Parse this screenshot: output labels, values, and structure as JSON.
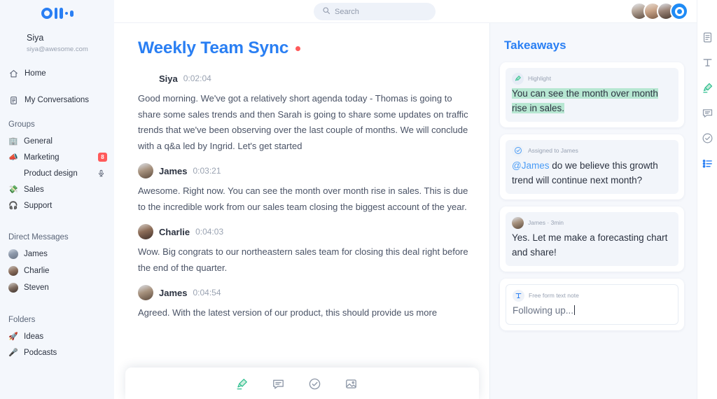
{
  "app": {
    "logo_name": "otter-logo"
  },
  "sidebar": {
    "user": {
      "name": "Siya",
      "email": "siya@awesome.com"
    },
    "nav": [
      {
        "label": "Home",
        "icon": "home-icon"
      },
      {
        "label": "My Conversations",
        "icon": "conversations-icon"
      }
    ],
    "groups_title": "Groups",
    "groups": [
      {
        "label": "General",
        "emoji": "🏢",
        "badge": ""
      },
      {
        "label": "Marketing",
        "emoji": "📣",
        "badge": "8"
      }
    ],
    "sub_item": {
      "label": "Product design",
      "icon": "microphone-icon"
    },
    "groups_after": [
      {
        "label": "Sales",
        "emoji": "💸",
        "badge": ""
      },
      {
        "label": "Support",
        "emoji": "🎧",
        "badge": ""
      }
    ],
    "dm_title": "Direct Messages",
    "dms": [
      {
        "label": "James"
      },
      {
        "label": "Charlie"
      },
      {
        "label": "Steven"
      }
    ],
    "folders_title": "Folders",
    "folders": [
      {
        "label": "Ideas",
        "emoji": "🚀"
      },
      {
        "label": "Podcasts",
        "emoji": "🎤"
      }
    ]
  },
  "topbar": {
    "search_placeholder": "Search",
    "search_value": "",
    "search_icon": "search-icon",
    "avatar_count": 3,
    "record_button_label": "record"
  },
  "transcript": {
    "title": "Weekly Team Sync",
    "recording_indicator": "live-recording-dot",
    "messages": [
      {
        "speaker": "Siya",
        "time": "0:02:04",
        "has_avatar": false,
        "text": "Good morning. We've got a relatively short agenda today - Thomas is going to share some sales trends and then Sarah is going to share some updates on traffic trends that we've been observing over the last couple of months. We will conclude with a q&a led by Ingrid. Let's get started"
      },
      {
        "speaker": "James",
        "time": "0:03:21",
        "has_avatar": true,
        "text": "Awesome. Right now. You can see the month over month rise in sales. This is due to the incredible work from our sales team closing the biggest account of the year."
      },
      {
        "speaker": "Charlie",
        "time": "0:04:03",
        "has_avatar": true,
        "text": "Wow. Big congrats to our northeastern sales team for closing this deal right before the end of the quarter."
      },
      {
        "speaker": "James",
        "time": "0:04:54",
        "has_avatar": true,
        "text": "Agreed. With the latest version of our product, this should provide us more"
      }
    ],
    "toolbar": [
      {
        "icon": "highlighter-icon",
        "label": "Highlight"
      },
      {
        "icon": "comment-icon",
        "label": "Comment"
      },
      {
        "icon": "action-item-icon",
        "label": "Action item"
      },
      {
        "icon": "image-icon",
        "label": "Add image"
      }
    ]
  },
  "takeaways": {
    "title": "Takeaways",
    "cards": [
      {
        "type": "highlight",
        "icon": "highlighter-icon",
        "meta": "Highlight",
        "text": "You can see the month over month rise in sales."
      },
      {
        "type": "action",
        "icon": "action-item-icon",
        "meta": "Assigned to James",
        "mention": "@James",
        "text": " do we believe this growth trend will continue next month?"
      },
      {
        "type": "comment",
        "icon": "avatar-james",
        "meta": "James · 3min",
        "text": "Yes. Let me make a forecasting chart and share!"
      },
      {
        "type": "note",
        "icon": "text-note-icon",
        "meta": "Free form text note",
        "text": "Following up..."
      }
    ]
  },
  "rail": {
    "items": [
      {
        "icon": "document-icon",
        "label": "Transcript"
      },
      {
        "icon": "text-note-icon",
        "label": "Text note"
      },
      {
        "icon": "highlighter-icon",
        "label": "Highlight"
      },
      {
        "icon": "comment-icon",
        "label": "Comment"
      },
      {
        "icon": "action-item-icon",
        "label": "Action item"
      },
      {
        "icon": "outline-list-icon",
        "label": "Outline"
      }
    ]
  },
  "colors": {
    "brand_blue": "#2a7ff3",
    "highlight_green": "#b7e7d2",
    "badge_red": "#ff5a5a",
    "sidebar_bg": "#f4f7fc",
    "panel_bg": "#f6f8fc"
  }
}
